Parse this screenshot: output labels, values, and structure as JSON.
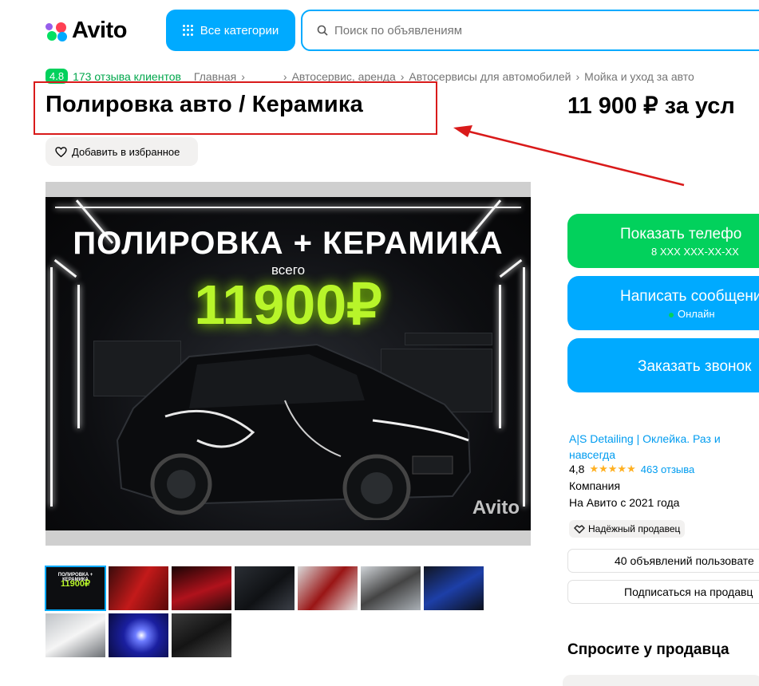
{
  "header": {
    "logo_text": "Avito",
    "categories_label": "Все категории",
    "search_placeholder": "Поиск по объявлениям"
  },
  "breadcrumbs": {
    "rating": "4.8",
    "reviews_link": "173 отзыва клиентов",
    "items": [
      "Главная",
      "Автосервис, аренда",
      "Автосервисы для автомобилей",
      "Мойка и уход за авто"
    ]
  },
  "listing": {
    "title": "Полировка авто / Керамика",
    "price": "11 900 ₽ за усл",
    "favorite_label": "Добавить в избранное"
  },
  "photo": {
    "headline": "ПОЛИРОВКА + КЕРАМИКА",
    "sub": "всего",
    "price": "11900₽",
    "watermark": "Avito"
  },
  "thumbnails": {
    "first_label": "ПОЛИРОВКА + КЕРАМИКА",
    "first_price": "11900₽"
  },
  "actions": {
    "show_phone": "Показать телефо",
    "phone_mask": "8 XXX XXX-XX-XX",
    "write_message": "Написать сообщени",
    "online": "Онлайн",
    "order_call": "Заказать звонок"
  },
  "seller": {
    "name": "A|S Detailing | Оклейка. Раз и навсегда",
    "rating": "4,8",
    "stars": "★★★★★",
    "reviews": "463 отзыва",
    "type": "Компания",
    "since": "На Авито с 2021 года",
    "trusted": "Надёжный продавец",
    "ads_count": "40 объявлений пользовате",
    "subscribe": "Подписаться на продавц"
  },
  "ask_seller": "Спросите у продавца",
  "colors": {
    "avito_blue": "#00aaff",
    "avito_green": "#02d15c",
    "annotation_red": "#d91a1a",
    "promo_green": "#b8f52a"
  }
}
